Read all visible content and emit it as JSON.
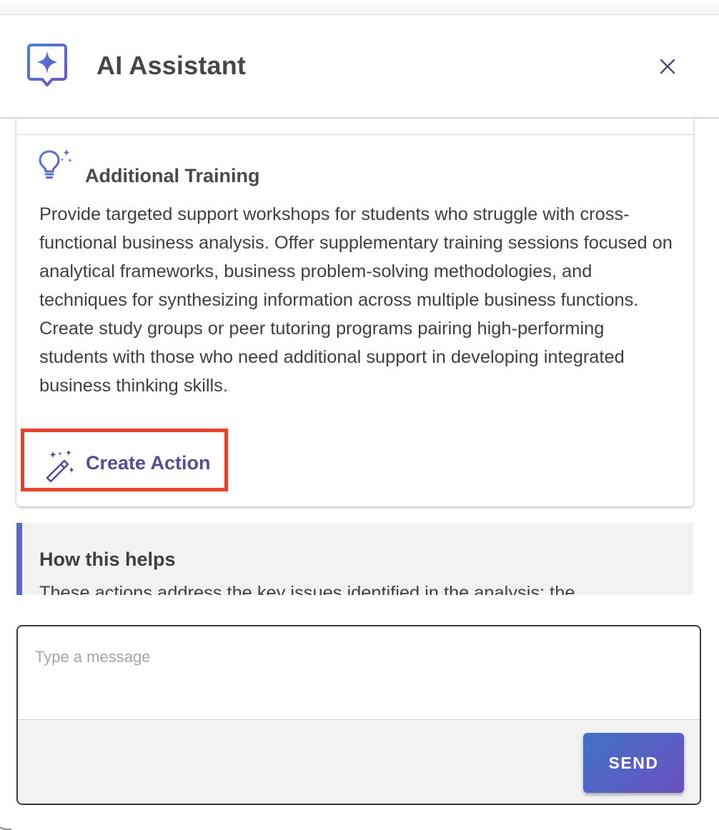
{
  "header": {
    "title": "AI Assistant",
    "close_label": "×"
  },
  "card": {
    "heading": "Additional Training",
    "body": "Provide targeted support workshops for students who struggle with cross-functional business analysis. Offer supplementary training sessions focused on analytical frameworks, business problem-solving methodologies, and techniques for synthesizing information across multiple business functions. Create study groups or peer tutoring programs pairing high-performing students with those who need additional support in developing integrated business thinking skills.",
    "action_label": "Create Action",
    "action_highlight_color": "#e8402c"
  },
  "helps": {
    "title": "How this helps",
    "text": "These actions address the key issues identified in the analysis: the"
  },
  "composer": {
    "placeholder": "Type a message",
    "send_label": "SEND"
  },
  "colors": {
    "accent": "#6068c7",
    "action_text": "#544c96",
    "send_gradient_start": "#3f72c4",
    "send_gradient_end": "#6a4fbf"
  },
  "icons": {
    "logo": "ai-assistant-logo-icon",
    "close": "close-icon",
    "bulb": "lightbulb-sparkle-icon",
    "wand": "magic-wand-icon"
  }
}
